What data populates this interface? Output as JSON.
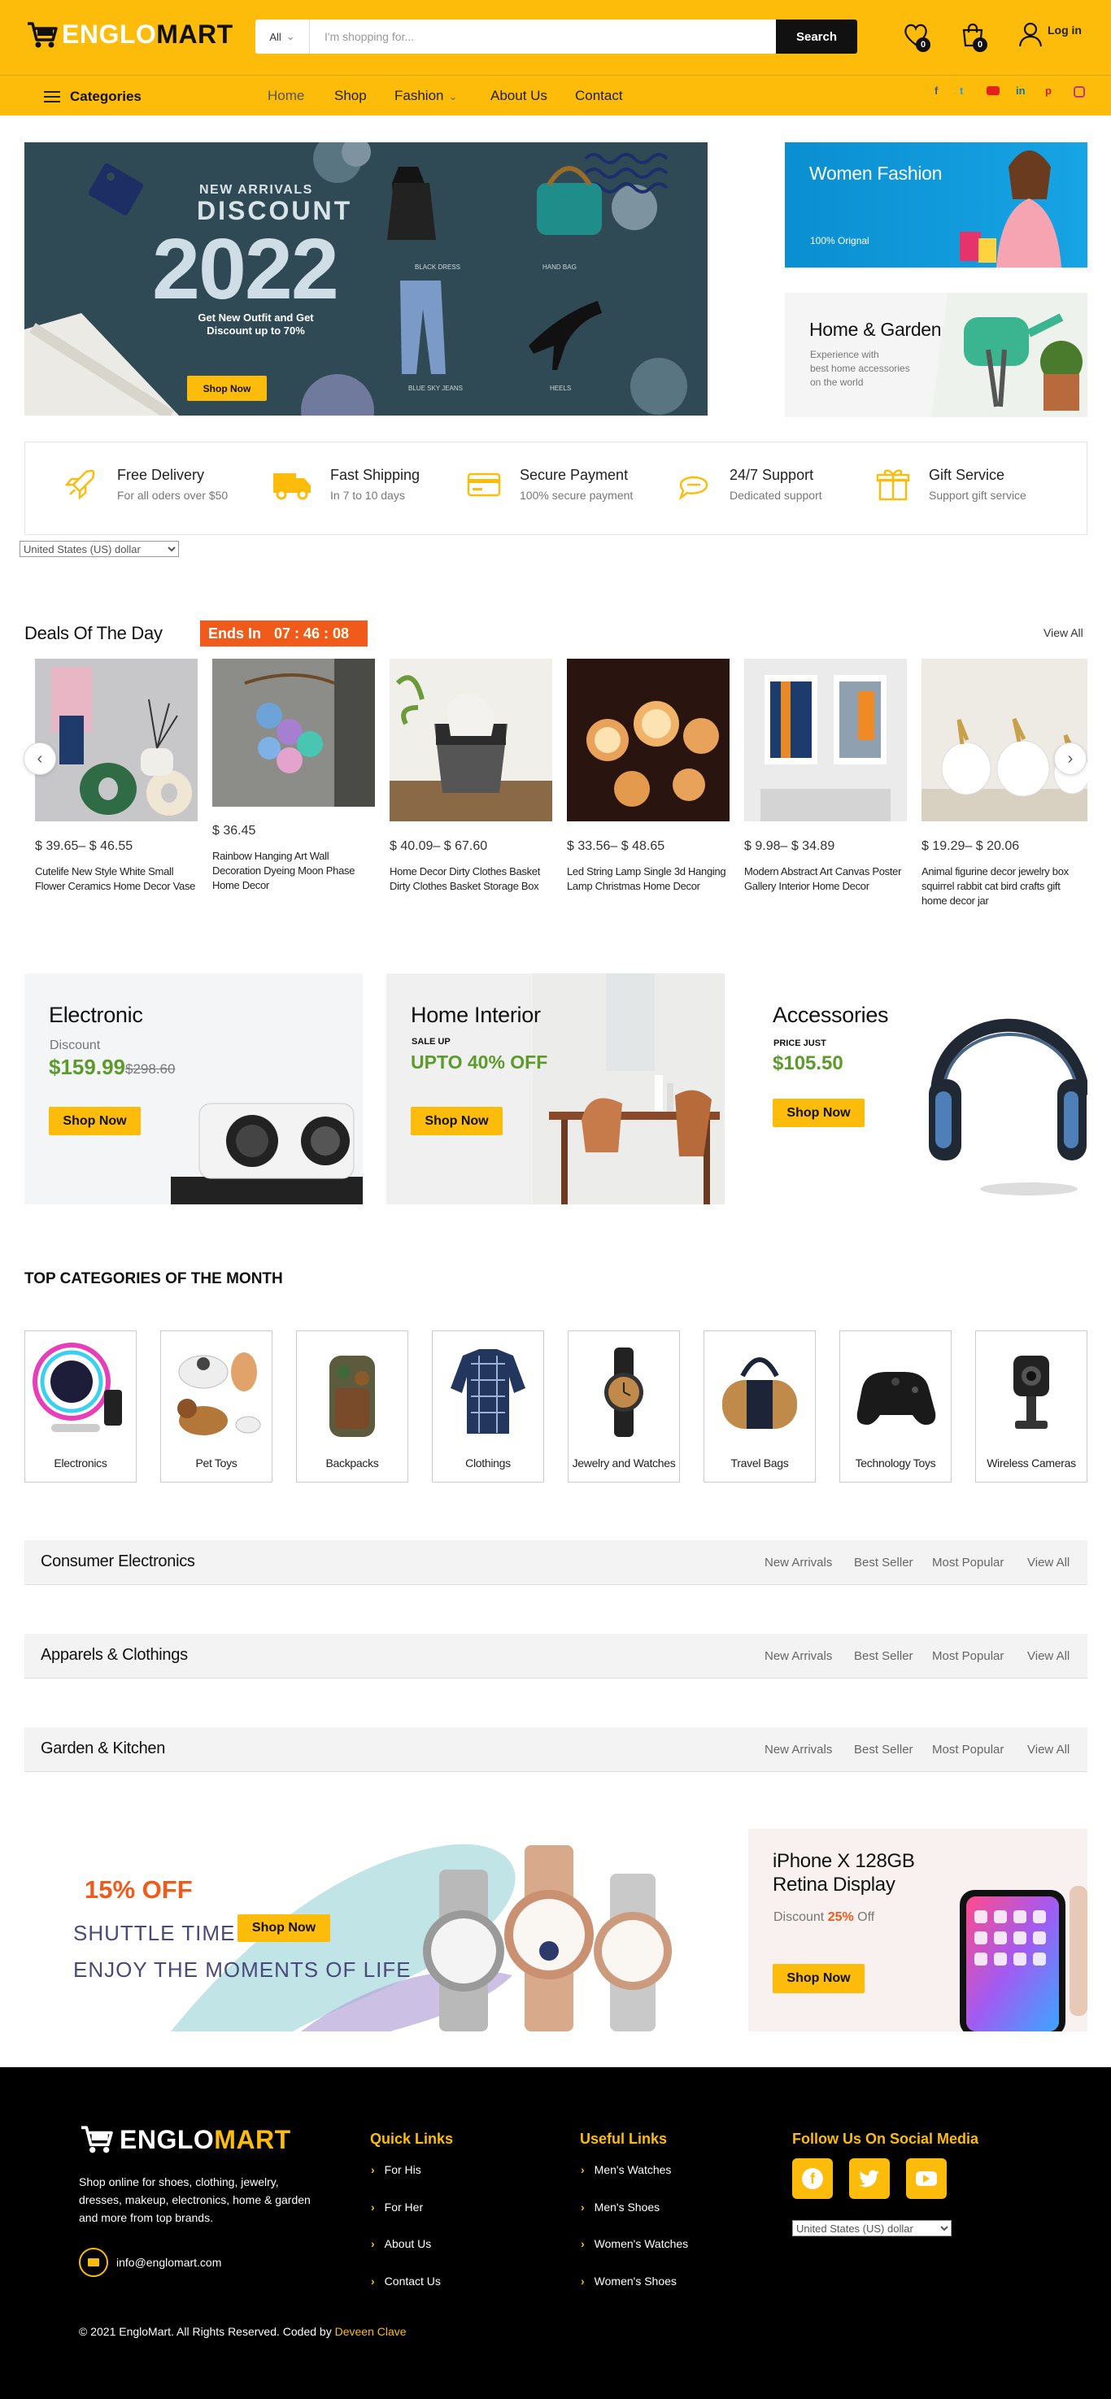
{
  "header": {
    "logo_prefix": "ENGLO",
    "logo_suffix": "MART",
    "search": {
      "category": "All",
      "placeholder": "I'm shopping for...",
      "button": "Search"
    },
    "wishlist_count": "0",
    "cart_count": "0",
    "login": "Log in"
  },
  "nav": {
    "categories": "Categories",
    "links": [
      "Home",
      "Shop",
      "Fashion",
      "About Us",
      "Contact"
    ],
    "social": [
      "f",
      "t",
      "yt",
      "in",
      "p",
      "ig"
    ]
  },
  "hero": {
    "eyebrow": "NEW ARRIVALS",
    "title": "DISCOUNT",
    "year": "2022",
    "subtitle_line1": "Get New Outfit and Get",
    "subtitle_line2": "Discount up to 70%",
    "button": "Shop Now",
    "items": [
      "BLACK DRESS",
      "HAND BAG",
      "BLUE SKY JEANS",
      "HEELS"
    ]
  },
  "side_banners": [
    {
      "title": "Women Fashion",
      "text": "100% Orignal"
    },
    {
      "title": "Home & Garden",
      "text_line1": "Experience with",
      "text_line2": "best home accessories",
      "text_line3": "on the world"
    }
  ],
  "features": [
    {
      "title": "Free Delivery",
      "text": "For all oders over $50",
      "icon": "rocket-icon"
    },
    {
      "title": "Fast Shipping",
      "text": "In 7 to 10 days",
      "icon": "truck-icon"
    },
    {
      "title": "Secure Payment",
      "text": "100% secure payment",
      "icon": "card-icon"
    },
    {
      "title": "24/7 Support",
      "text": "Dedicated support",
      "icon": "chat-icon"
    },
    {
      "title": "Gift Service",
      "text": "Support gift service",
      "icon": "gift-icon"
    }
  ],
  "currency": "United States (US) dollar",
  "deals": {
    "title": "Deals Of The Day",
    "ends_label": "Ends In",
    "timer": "07 : 46 : 08",
    "view_all": "View All",
    "products": [
      {
        "price": "$ 39.65– $ 46.55",
        "name": "Cutelife New Style White Small Flower Ceramics Home Decor Vase"
      },
      {
        "price": "$ 36.45",
        "name": "Rainbow Hanging Art Wall Decoration Dyeing Moon Phase Home Decor"
      },
      {
        "price": "$ 40.09– $ 67.60",
        "name": "Home Decor Dirty Clothes Basket Dirty Clothes Basket Storage Box"
      },
      {
        "price": "$ 33.56– $ 48.65",
        "name": "Led String Lamp Single 3d Hanging Lamp Christmas Home Decor"
      },
      {
        "price": "$ 9.98– $ 34.89",
        "name": "Modern Abstract Art Canvas Poster Gallery Interior Home Decor"
      },
      {
        "price": "$ 19.29– $ 20.06",
        "name": "Animal figurine decor jewelry box squirrel rabbit cat bird crafts gift home decor jar"
      }
    ]
  },
  "promos": [
    {
      "title": "Electronic",
      "label": "Discount",
      "price": "$159.99",
      "old_price": "$298.60",
      "button": "Shop Now"
    },
    {
      "title": "Home Interior",
      "label": "SALE UP",
      "price": "UPTO 40% OFF",
      "button": "Shop Now"
    },
    {
      "title": "Accessories",
      "label": "PRICE JUST",
      "price": "$105.50",
      "button": "Shop Now"
    }
  ],
  "top_categories": {
    "title": "TOP CATEGORIES OF THE MONTH",
    "items": [
      "Electronics",
      "Pet Toys",
      "Backpacks",
      "Clothings",
      "Jewelry and Watches",
      "Travel Bags",
      "Technology Toys",
      "Wireless Cameras"
    ]
  },
  "sections": [
    {
      "title": "Consumer Electronics"
    },
    {
      "title": "Apparels & Clothings"
    },
    {
      "title": "Garden & Kitchen"
    }
  ],
  "section_tabs": [
    "New Arrivals",
    "Best Seller",
    "Most Popular",
    "View All"
  ],
  "watch_banner": {
    "discount": "15% OFF",
    "line1": "SHUTTLE TIME",
    "line2": "ENJOY THE MOMENTS OF LIFE",
    "button": "Shop Now"
  },
  "iphone_banner": {
    "line1": "iPhone X 128GB",
    "line2": "Retina Display",
    "discount_prefix": "Discount ",
    "discount_value": "25%",
    "discount_suffix": " Off",
    "button": "Shop Now"
  },
  "footer": {
    "about": "Shop online for shoes, clothing, jewelry, dresses, makeup, electronics, home & garden and more from top brands.",
    "email": "info@englomart.com",
    "quick_links_title": "Quick Links",
    "quick_links": [
      "For His",
      "For Her",
      "About Us",
      "Contact Us"
    ],
    "useful_links_title": "Useful Links",
    "useful_links": [
      "Men's Watches",
      "Men's Shoes",
      "Women's Watches",
      "Women's Shoes"
    ],
    "social_title": "Follow Us On Social Media",
    "copyright": "© 2021 EngloMart. All Rights Reserved. Coded by ",
    "coder": "Deveen Clave"
  },
  "colors": {
    "accent": "#fdbb0a",
    "deal_timer": "#f05a1a",
    "price_green": "#5c9a2c",
    "footer_bg": "#000000"
  }
}
